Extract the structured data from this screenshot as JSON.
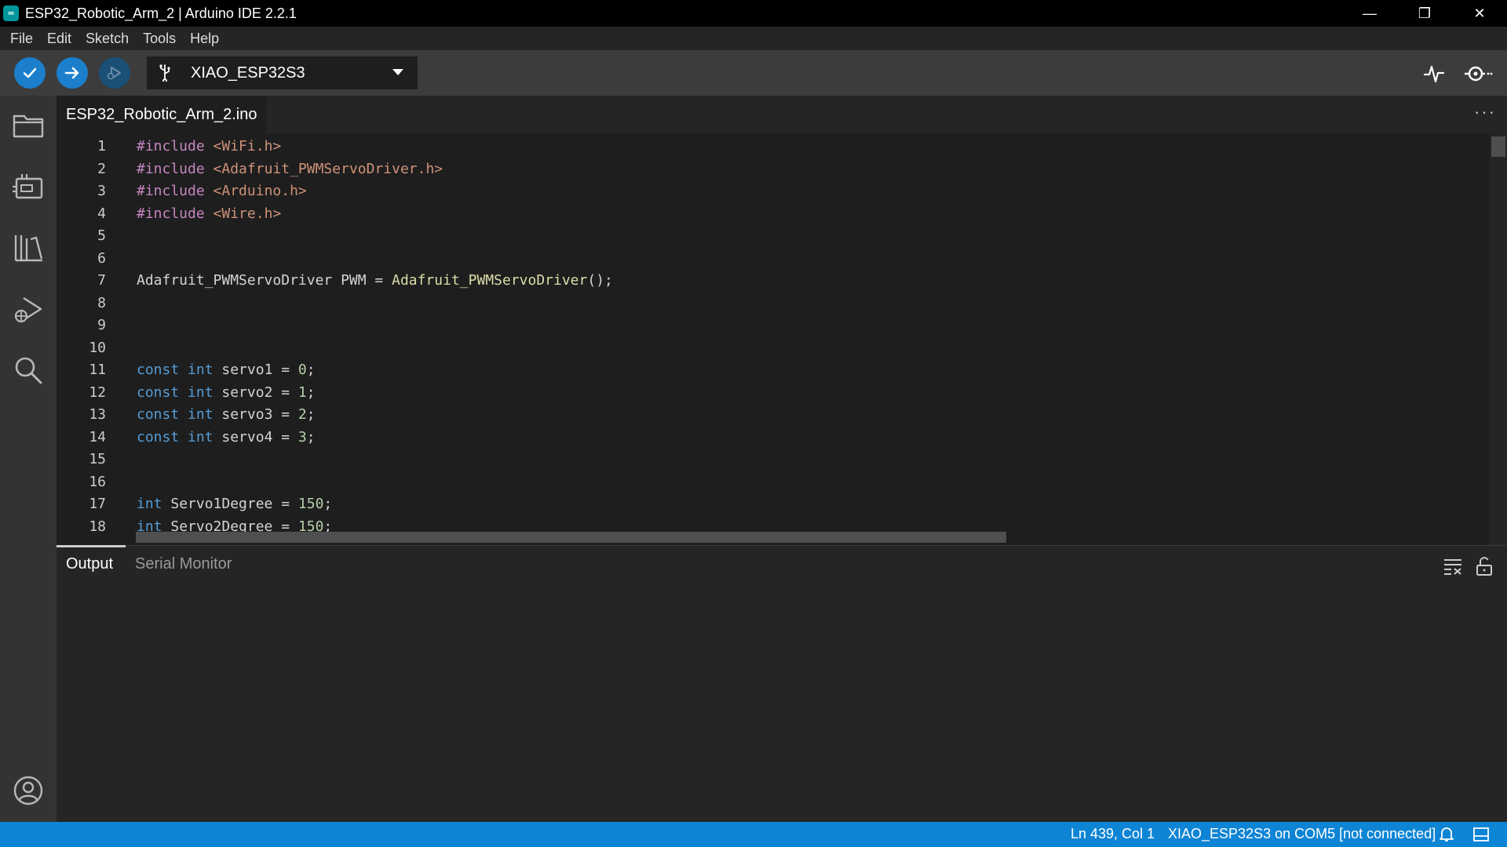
{
  "window": {
    "title": "ESP32_Robotic_Arm_2 | Arduino IDE 2.2.1",
    "controls": [
      "—",
      "❐",
      "✕"
    ]
  },
  "menu": [
    "File",
    "Edit",
    "Sketch",
    "Tools",
    "Help"
  ],
  "toolbar": {
    "board": "XIAO_ESP32S3",
    "verify_icon": "check-icon",
    "upload_icon": "arrow-right-icon",
    "debug_icon": "debug-icon",
    "plotter_icon": "serial-plotter-icon",
    "monitor_icon": "serial-monitor-icon"
  },
  "sidebar": [
    "folder-icon",
    "board-icon",
    "library-icon",
    "debug-icon",
    "search-icon"
  ],
  "editor": {
    "tab": "ESP32_Robotic_Arm_2.ino",
    "more": "···",
    "lines": [
      {
        "n": "1",
        "tokens": [
          {
            "c": "inc",
            "t": "#include "
          },
          {
            "c": "hdr",
            "t": "<WiFi.h>"
          }
        ]
      },
      {
        "n": "2",
        "tokens": [
          {
            "c": "inc",
            "t": "#include "
          },
          {
            "c": "hdr",
            "t": "<Adafruit_PWMServoDriver.h>"
          }
        ]
      },
      {
        "n": "3",
        "tokens": [
          {
            "c": "inc",
            "t": "#include "
          },
          {
            "c": "hdr",
            "t": "<Arduino.h>"
          }
        ]
      },
      {
        "n": "4",
        "tokens": [
          {
            "c": "inc",
            "t": "#include "
          },
          {
            "c": "hdr",
            "t": "<Wire.h>"
          }
        ]
      },
      {
        "n": "5",
        "tokens": []
      },
      {
        "n": "6",
        "tokens": []
      },
      {
        "n": "7",
        "tokens": [
          {
            "c": "plain",
            "t": "Adafruit_PWMServoDriver PWM = "
          },
          {
            "c": "fn",
            "t": "Adafruit_PWMServoDriver"
          },
          {
            "c": "plain",
            "t": "();"
          }
        ]
      },
      {
        "n": "8",
        "tokens": []
      },
      {
        "n": "9",
        "tokens": []
      },
      {
        "n": "10",
        "tokens": []
      },
      {
        "n": "11",
        "tokens": [
          {
            "c": "kw",
            "t": "const int"
          },
          {
            "c": "plain",
            "t": " servo1 = "
          },
          {
            "c": "num",
            "t": "0"
          },
          {
            "c": "plain",
            "t": ";"
          }
        ]
      },
      {
        "n": "12",
        "tokens": [
          {
            "c": "kw",
            "t": "const int"
          },
          {
            "c": "plain",
            "t": " servo2 = "
          },
          {
            "c": "num",
            "t": "1"
          },
          {
            "c": "plain",
            "t": ";"
          }
        ]
      },
      {
        "n": "13",
        "tokens": [
          {
            "c": "kw",
            "t": "const int"
          },
          {
            "c": "plain",
            "t": " servo3 = "
          },
          {
            "c": "num",
            "t": "2"
          },
          {
            "c": "plain",
            "t": ";"
          }
        ]
      },
      {
        "n": "14",
        "tokens": [
          {
            "c": "kw",
            "t": "const int"
          },
          {
            "c": "plain",
            "t": " servo4 = "
          },
          {
            "c": "num",
            "t": "3"
          },
          {
            "c": "plain",
            "t": ";"
          }
        ]
      },
      {
        "n": "15",
        "tokens": []
      },
      {
        "n": "16",
        "tokens": []
      },
      {
        "n": "17",
        "tokens": [
          {
            "c": "kw",
            "t": "int"
          },
          {
            "c": "plain",
            "t": " Servo1Degree = "
          },
          {
            "c": "num",
            "t": "150"
          },
          {
            "c": "plain",
            "t": ";"
          }
        ]
      },
      {
        "n": "18",
        "tokens": [
          {
            "c": "kw",
            "t": "int"
          },
          {
            "c": "plain",
            "t": " Servo2Degree = "
          },
          {
            "c": "num",
            "t": "150"
          },
          {
            "c": "plain",
            "t": ";"
          }
        ]
      }
    ]
  },
  "panel": {
    "tabs": [
      "Output",
      "Serial Monitor"
    ],
    "active_tab": "Output"
  },
  "status": {
    "position": "Ln 439, Col 1",
    "connection": "XIAO_ESP32S3 on COM5 [not connected]"
  },
  "colors": {
    "accent": "#0e84d4",
    "verify_button": "#1b7fcc",
    "include": "#c586c0",
    "header_string": "#ce9178",
    "keyword": "#569cd6",
    "number": "#b5cea8",
    "function": "#dcdcaa"
  }
}
